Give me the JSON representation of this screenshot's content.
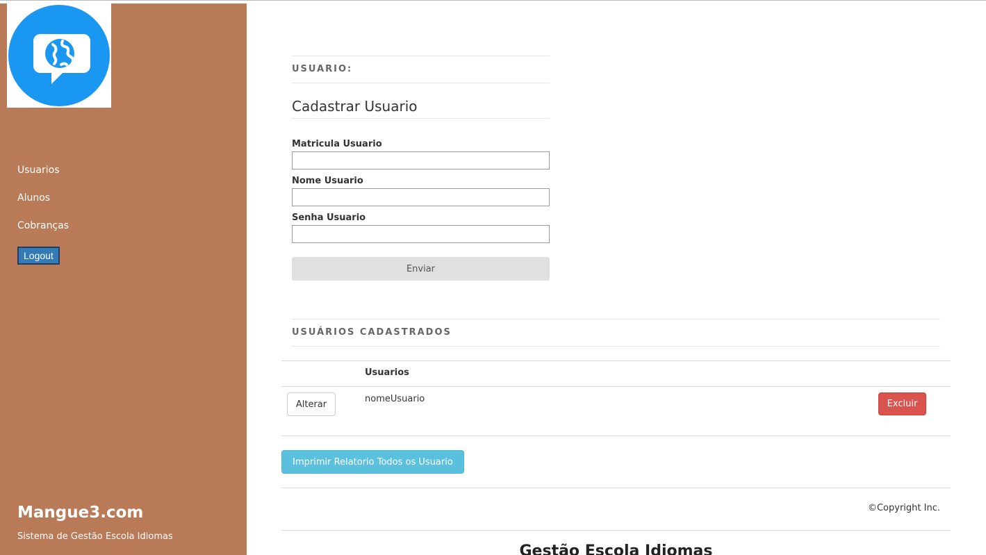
{
  "sidebar": {
    "logo_icon": "chat-globe-icon",
    "logo_color": "#1a97f0",
    "background": "#b87a57",
    "nav": [
      {
        "label": "Usuarios"
      },
      {
        "label": "Alunos"
      },
      {
        "label": "Cobranças"
      }
    ],
    "logout_label": "Logout",
    "brand": "Mangue3.com",
    "brand_sub": "Sistema de Gestão Escola Idiomas"
  },
  "form": {
    "section_title": "USUARIO:",
    "title": "Cadastrar Usuario",
    "fields": [
      {
        "label": "Matricula Usuario",
        "value": ""
      },
      {
        "label": "Nome Usuario",
        "value": ""
      },
      {
        "label": "Senha Usuario",
        "value": ""
      }
    ],
    "submit_label": "Enviar"
  },
  "table": {
    "section_title": "USUÁRIOS CADASTRADOS",
    "header": "Usuarios",
    "rows": [
      {
        "name": "nomeUsuario",
        "edit_label": "Alterar",
        "delete_label": "Excluir"
      }
    ]
  },
  "report_button": "Imprimir Relatorio Todos os Usuario",
  "footer": {
    "copyright": "©Copyright Inc.",
    "title": "Gestão Escola Idiomas"
  }
}
